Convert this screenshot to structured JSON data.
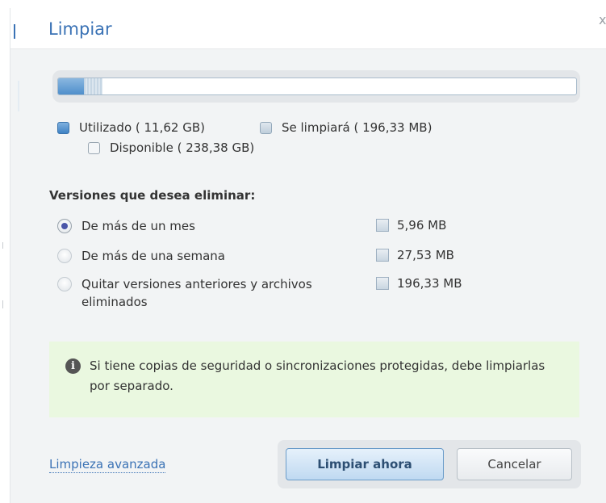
{
  "dialog": {
    "title": "Limpiar",
    "close_glyph": "x"
  },
  "storage_bar": {
    "used_fraction": 0.05,
    "to_clean_fraction": 0.035
  },
  "legend": {
    "used": "Utilizado ( 11,62 GB)",
    "to_clean": "Se limpiará ( 196,33 MB)",
    "free": "Disponible ( 238,38 GB)"
  },
  "versions": {
    "label": "Versiones que desea eliminar:",
    "options": [
      {
        "label": "De más de un mes",
        "size": "5,96 MB",
        "selected": true
      },
      {
        "label": "De más de una semana",
        "size": "27,53 MB",
        "selected": false
      },
      {
        "label": "Quitar versiones anteriores y archivos eliminados",
        "size": "196,33 MB",
        "selected": false
      }
    ]
  },
  "info": {
    "icon": "info-icon",
    "text": "Si tiene copias de seguridad o sincronizaciones protegidas, debe limpiarlas por separado."
  },
  "footer": {
    "advanced_link": "Limpieza avanzada",
    "primary_button": "Limpiar ahora",
    "cancel_button": "Cancelar"
  },
  "colors": {
    "accent": "#3a72b5",
    "info_bg": "#eaf8e0",
    "dialog_bg": "#f2f4f5"
  }
}
